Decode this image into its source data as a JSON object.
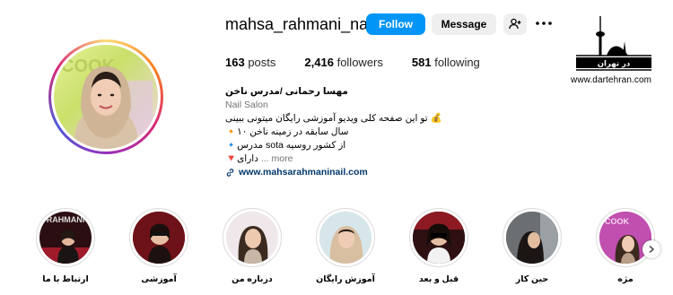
{
  "profile": {
    "username": "mahsa_rahmani_nail",
    "follow_label": "Follow",
    "message_label": "Message",
    "stats": {
      "posts_count": "163",
      "posts_label": "posts",
      "followers_count": "2,416",
      "followers_label": "followers",
      "following_count": "581",
      "following_label": "following"
    },
    "bio": {
      "name": "مهسا رحمانی /مدرس ناخن",
      "category": "Nail Salon",
      "line1": "تو این صفحه کلی ویدیو آموزشی رایگان میتونی ببینی 💰",
      "line2": "🔸۱۰ سال سابقه در زمینه ناخن",
      "line3": "🔹مدرس sota از کشور روسیه",
      "line4": "🔻دارای",
      "more_label": "... more",
      "link": "www.mahsarahmaninail.com"
    },
    "avatar_text": "COOK"
  },
  "watermark": {
    "brand": "در تهران",
    "url": "www.dartehran.com"
  },
  "highlights": [
    {
      "label": "ارتباط با ما",
      "cover_text": "RAHMANI"
    },
    {
      "label": "آموزشی"
    },
    {
      "label": "درباره من"
    },
    {
      "label": "آموزش رایگان"
    },
    {
      "label": "قبل و بعد"
    },
    {
      "label": "حین کار"
    },
    {
      "label": "مژه",
      "cover_text": "COOK"
    }
  ],
  "colors": {
    "follow_button": "#0095f6",
    "secondary_button": "#efefef",
    "link": "#00376b",
    "muted_text": "#737373"
  }
}
